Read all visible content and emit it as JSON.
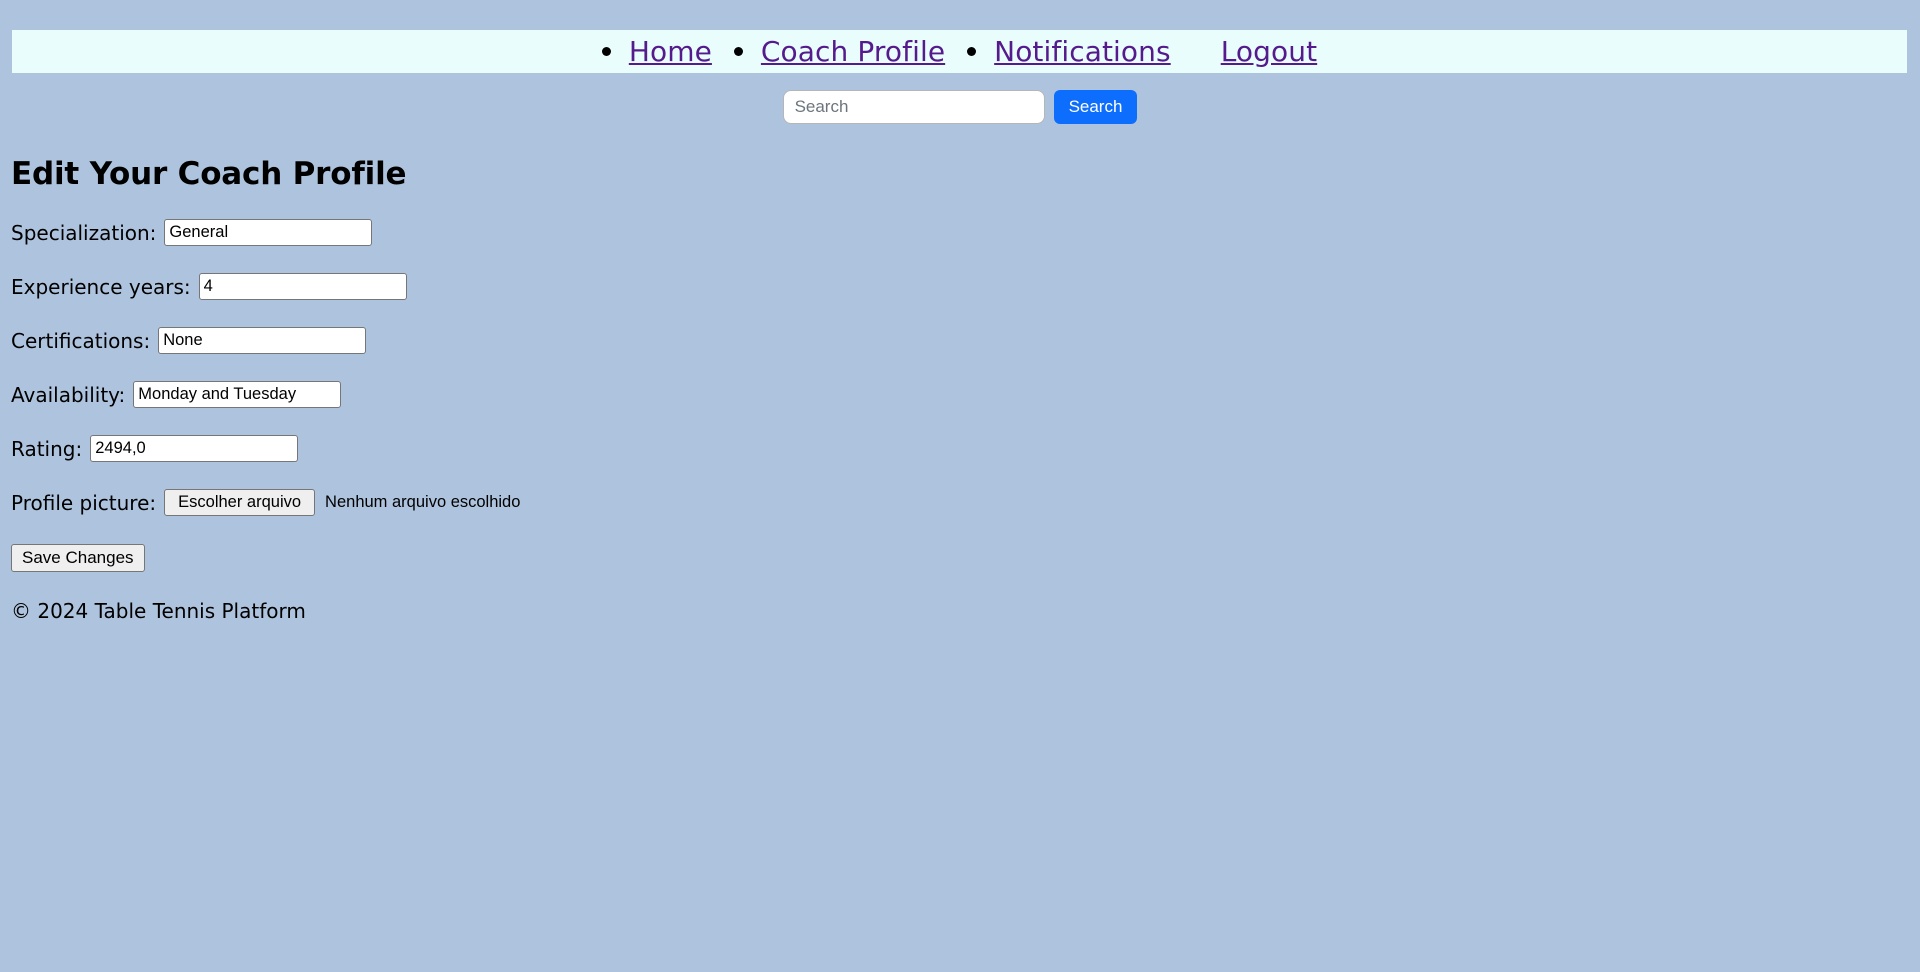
{
  "nav": {
    "items": [
      {
        "label": "Home",
        "bullet": true
      },
      {
        "label": "Coach Profile",
        "bullet": true
      },
      {
        "label": "Notifications",
        "bullet": true
      },
      {
        "label": "Logout",
        "bullet": false
      }
    ]
  },
  "search": {
    "placeholder": "Search",
    "value": "",
    "button_label": "Search",
    "button_color": "#0d6efd"
  },
  "main": {
    "title": "Edit Your Coach Profile",
    "fields": [
      {
        "label": "Specialization:",
        "value": "General"
      },
      {
        "label": "Experience years:",
        "value": "4"
      },
      {
        "label": "Certifications:",
        "value": "None"
      },
      {
        "label": "Availability:",
        "value": "Monday and Tuesday"
      },
      {
        "label": "Rating:",
        "value": "2494,0"
      }
    ],
    "profile_picture": {
      "label": "Profile picture:",
      "choose_button": "Escolher arquivo",
      "status": "Nenhum arquivo escolhido"
    },
    "save_label": "Save Changes"
  },
  "footer": {
    "text": "© 2024 Table Tennis Platform"
  },
  "colors": {
    "page_background": "#aec4de",
    "navbar_background": "#e9fdfd",
    "link": "#551a8b",
    "accent": "#0d6efd"
  }
}
